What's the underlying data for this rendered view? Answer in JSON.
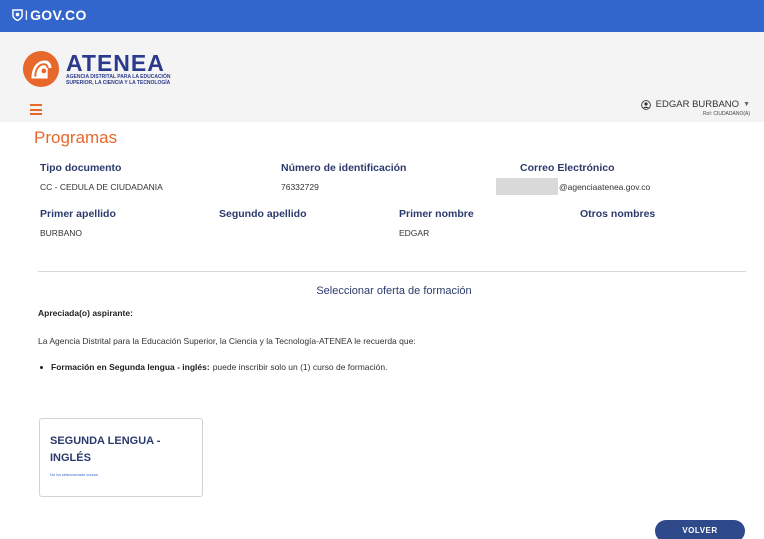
{
  "gov_bar": {
    "logo_text": "GOV.CO",
    "separator": "|"
  },
  "brand": {
    "name": "ATENEA",
    "subtitle_line1": "AGENCIA DISTRITAL PARA LA EDUCACIÓN",
    "subtitle_line2": "SUPERIOR, LA CIENCIA Y LA TECNOLOGÍA"
  },
  "user": {
    "name": "EDGAR BURBANO",
    "role": "Rol: CIUDADANO(A)"
  },
  "page": {
    "title": "Programas"
  },
  "profile": {
    "tipo_documento": {
      "label": "Tipo documento",
      "value": "CC - CEDULA DE CIUDADANIA"
    },
    "numero_identificacion": {
      "label": "Número de identificación",
      "value": "76332729"
    },
    "correo": {
      "label": "Correo Electrónico",
      "value": "@agenciaatenea.gov.co"
    },
    "primer_apellido": {
      "label": "Primer apellido",
      "value": "BURBANO"
    },
    "segundo_apellido": {
      "label": "Segundo apellido",
      "value": ""
    },
    "primer_nombre": {
      "label": "Primer nombre",
      "value": "EDGAR"
    },
    "otros_nombres": {
      "label": "Otros nombres",
      "value": ""
    }
  },
  "oferta": {
    "section_title": "Seleccionar oferta de formación",
    "greeting": "Apreciada(o) aspirante:",
    "notice": "La Agencia Distrital para la Educación Superior, la Ciencia y la Tecnología-ATENEA le recuerda que:",
    "bullet_bold": "Formación en Segunda lengua - inglés:",
    "bullet_text": "puede inscribir solo un (1) curso de formación."
  },
  "card": {
    "title": "SEGUNDA LENGUA - INGLÉS",
    "note": "No ha seleccionado cursos"
  },
  "actions": {
    "volver": "VOLVER"
  },
  "colors": {
    "gov_blue": "#3366cc",
    "brand_orange": "#e8672b",
    "label_navy": "#2b3a6c",
    "button_navy": "#2f4a8a"
  },
  "icons": [
    "shield-icon",
    "atenea-logo-icon",
    "hamburger-menu-icon",
    "user-circle-icon",
    "caret-down-icon"
  ]
}
